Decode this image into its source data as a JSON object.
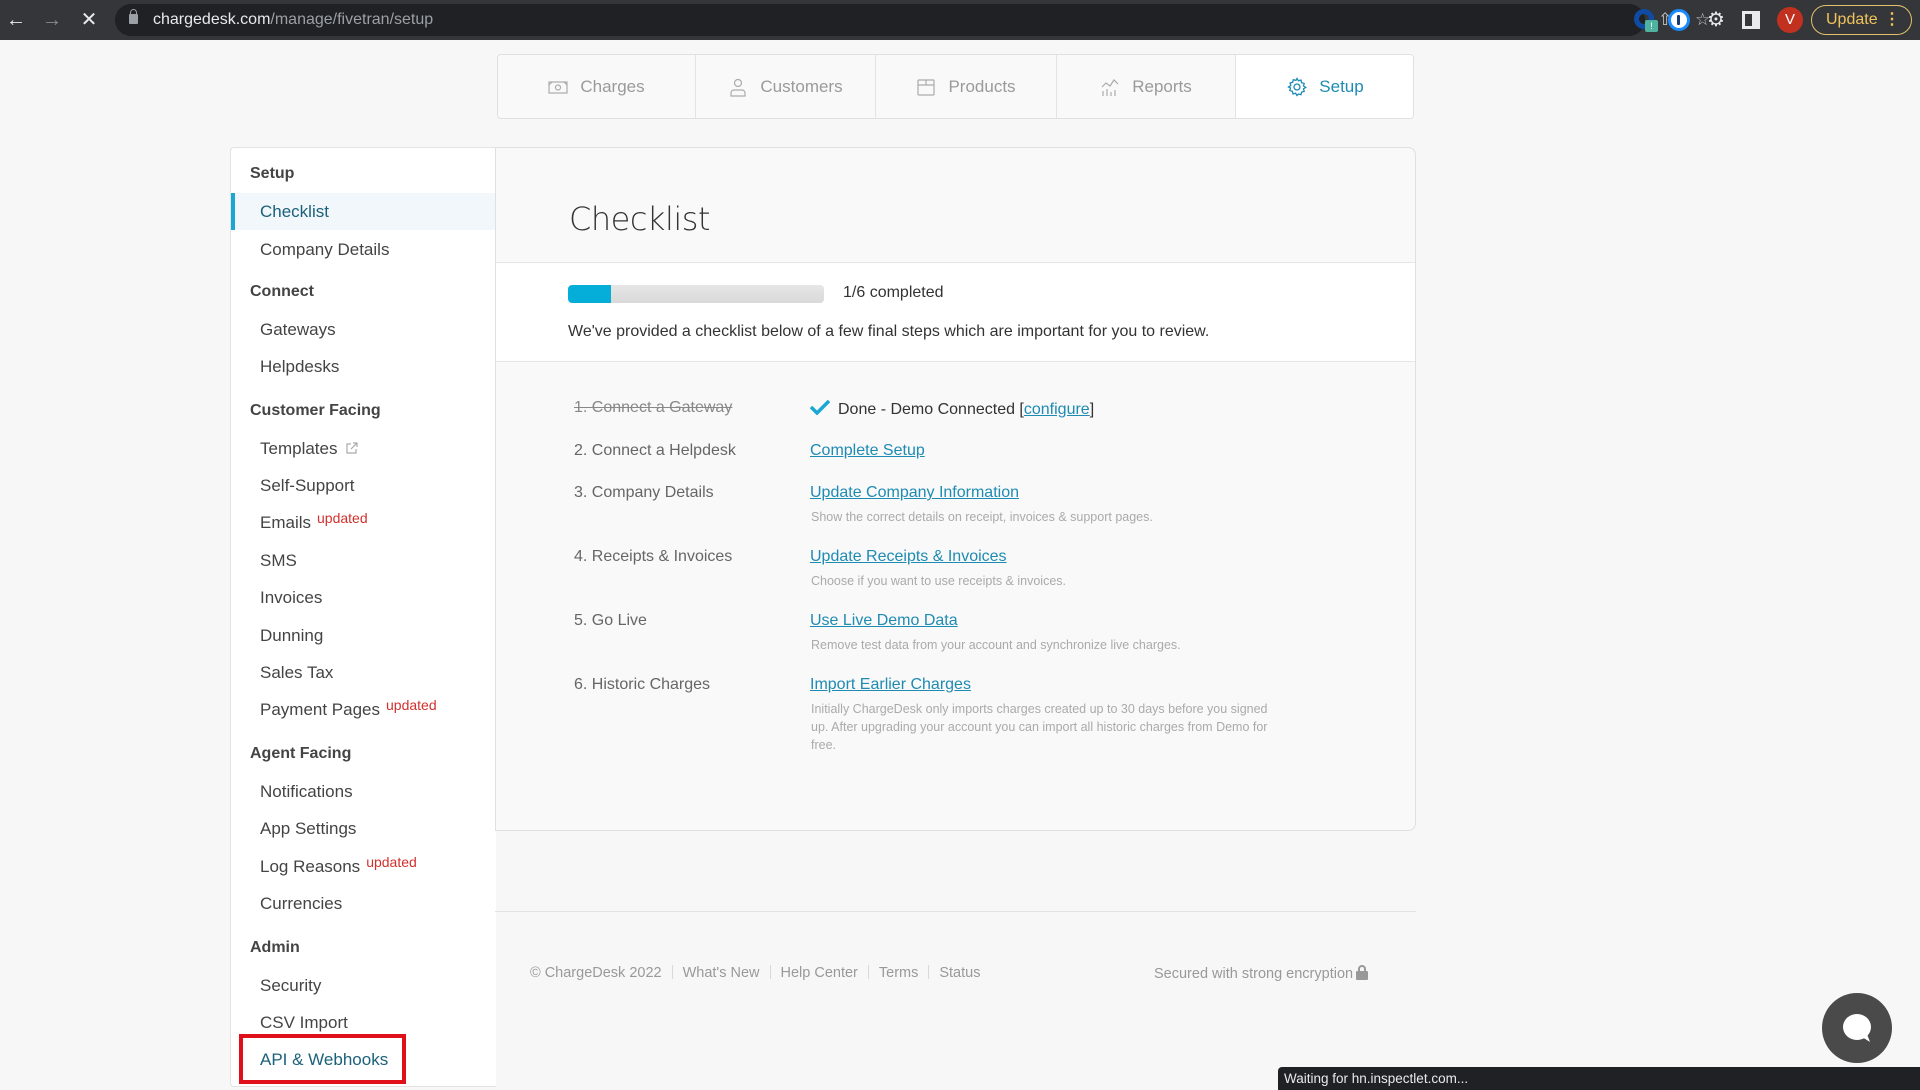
{
  "browser": {
    "url_host": "chargedesk.com",
    "url_path": "/manage/fivetran/setup",
    "avatar_initial": "V",
    "update_label": "Update",
    "extension_badge": "!",
    "status_text": "Waiting for hn.inspectlet.com..."
  },
  "topnav": {
    "tabs": [
      {
        "label": "Charges",
        "icon": "money-icon",
        "active": false
      },
      {
        "label": "Customers",
        "icon": "user-icon",
        "active": false
      },
      {
        "label": "Products",
        "icon": "box-icon",
        "active": false
      },
      {
        "label": "Reports",
        "icon": "chart-icon",
        "active": false
      },
      {
        "label": "Setup",
        "icon": "gear-icon",
        "active": true
      }
    ]
  },
  "sidebar": {
    "sections": [
      {
        "heading": "Setup",
        "items": [
          {
            "label": "Checklist",
            "active": true
          },
          {
            "label": "Company Details"
          }
        ]
      },
      {
        "heading": "Connect",
        "items": [
          {
            "label": "Gateways"
          },
          {
            "label": "Helpdesks"
          }
        ]
      },
      {
        "heading": "Customer Facing",
        "items": [
          {
            "label": "Templates",
            "external": true
          },
          {
            "label": "Self-Support"
          },
          {
            "label": "Emails",
            "badge": "updated"
          },
          {
            "label": "SMS"
          },
          {
            "label": "Invoices"
          },
          {
            "label": "Dunning"
          },
          {
            "label": "Sales Tax"
          },
          {
            "label": "Payment Pages",
            "badge": "updated"
          }
        ]
      },
      {
        "heading": "Agent Facing",
        "items": [
          {
            "label": "Notifications"
          },
          {
            "label": "App Settings"
          },
          {
            "label": "Log Reasons",
            "badge": "updated"
          },
          {
            "label": "Currencies"
          }
        ]
      },
      {
        "heading": "Admin",
        "items": [
          {
            "label": "Security"
          },
          {
            "label": "CSV Import"
          },
          {
            "label": "API & Webhooks",
            "highlighted": true
          }
        ]
      }
    ]
  },
  "main": {
    "title": "Checklist",
    "progress": {
      "completed": 1,
      "total": 6,
      "fraction": 0.1667,
      "label": "1/6 completed"
    },
    "intro": "We've provided a checklist below of a few final steps which are important for you to review.",
    "colors": {
      "accent": "#1e8bb3",
      "progress_fill": "#05aed8",
      "updated_badge": "#d0312d",
      "highlight_box": "#e0101a"
    },
    "steps": [
      {
        "step": "1. Connect a Gateway",
        "done": true,
        "status_prefix": "Done - Demo Connected [",
        "status_link": "configure",
        "status_suffix": "]"
      },
      {
        "step": "2. Connect a Helpdesk",
        "action": "Complete Setup",
        "desc": ""
      },
      {
        "step": "3. Company Details",
        "action": "Update Company Information",
        "desc": "Show the correct details on receipt, invoices & support pages."
      },
      {
        "step": "4. Receipts & Invoices",
        "action": "Update Receipts & Invoices",
        "desc": "Choose if you want to use receipts & invoices."
      },
      {
        "step": "5. Go Live",
        "action": "Use Live Demo Data",
        "desc": "Remove test data from your account and synchronize live charges."
      },
      {
        "step": "6. Historic Charges",
        "action": "Import Earlier Charges",
        "desc": "Initially ChargeDesk only imports charges created up to 30 days before you signed up. After upgrading your account you can import all historic charges from Demo for free."
      }
    ]
  },
  "footer": {
    "copyright": "© ChargeDesk 2022",
    "links": [
      "What's New",
      "Help Center",
      "Terms",
      "Status"
    ],
    "secure": "Secured with strong encryption"
  }
}
